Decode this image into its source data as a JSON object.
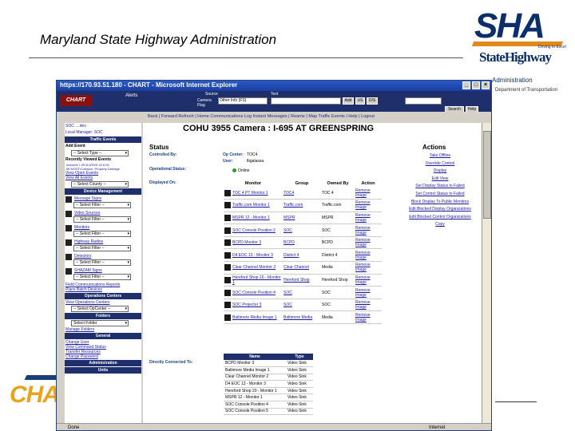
{
  "slide": {
    "title": "Maryland State Highway Administration",
    "logo": {
      "big": "SHA",
      "sub1": "StateHighway",
      "sub2": "Administration",
      "tiny": "Driving to Excel"
    },
    "side_text": "Department of Transportation",
    "bottom_logo": "CHA"
  },
  "browser": {
    "title": "https://170.93.51.180 - CHART - Microsoft Internet Explorer",
    "controls": [
      "_",
      "□",
      "×"
    ],
    "app_logo": "CHART",
    "alerts_label": "Alerts",
    "camera_label": "Camera Flag",
    "source_label": "Source",
    "text_label": "Text",
    "camera_select": "Other Info (FS)",
    "buttons": {
      "add": "Add",
      "us": "US",
      "dis": "D/S",
      "search": "Search",
      "help": "Help"
    },
    "menu": "Back | Forward   Refresh | Home   Communications Log   Instant Messages | Reame | Map   Traffic Events | Help | Logout",
    "status_text": "Done",
    "zone_text": "Internet"
  },
  "sidebar": {
    "top_lines": [
      "SOC  ....dev",
      "Local Manager: SOC"
    ],
    "traffic_events": {
      "header": "Traffic Events",
      "add_event_label": "Add Event",
      "select_type": "-- Select Type --",
      "recent_label": "Recently Viewed Events",
      "recent_items": [
        "Incident: I-95 at ATMS 20 A  00",
        "Mt MOST/Collision, Property Damage"
      ],
      "view_open": "View Open Events",
      "view_all": "View All Events",
      "select_county": "-- Select County --"
    },
    "device_mgmt": {
      "header": "Device Management",
      "items": [
        {
          "label": "Message Signs",
          "select": "-- Select Filter --"
        },
        {
          "label": "Video Sources",
          "select": "-- Select Filter --"
        },
        {
          "label": "Monitors",
          "select": "-- Select Filter --"
        },
        {
          "label": "Highway Radios",
          "select": "-- Select Filter --"
        },
        {
          "label": "Detectors",
          "select": "-- Select Filter --"
        },
        {
          "label": "SHAZAM Signs",
          "select": "-- Select Filter --"
        }
      ],
      "field_comm": "Field Communications Reports",
      "plans": "Plans Batch Devices"
    },
    "ops_centers": {
      "header": "Operations Centers",
      "view": "View Operations Centers",
      "select": "-- Select OpCenter --"
    },
    "folders": {
      "header": "Folders",
      "select": "Select Folder",
      "manage": "Manage Folders"
    },
    "general": {
      "header": "General",
      "links": [
        "Change User",
        "View Command Status",
        "Transfer Resources",
        "Change Password"
      ]
    },
    "admin": {
      "header": "Administration",
      "sub": "Units"
    }
  },
  "main": {
    "title": "COHU 3955 Camera : I-695 AT GREENSPRING",
    "status_heading": "Status",
    "controlled_by_label": "Controlled By:",
    "op_center_label": "Op Center:",
    "op_center_value": "TOC4",
    "user_label": "User:",
    "user_value": "lbgalassa",
    "op_status_label": "Operational Status:",
    "online": "Online",
    "displayed_on_label": "Displayed On:",
    "directly_connected_label": "Directly Connected To:",
    "actions_heading": "Actions",
    "actions": [
      "Take Offline",
      "Override Control",
      "Display",
      "Edit View",
      "Set Display Status to Failed",
      "Set Control Status to Failed",
      "Block Display To Public Monitors",
      "Edit Blocked Display Organizations",
      "Edit Blocked Control Organizations",
      "Copy"
    ],
    "monitor_table": {
      "headers": [
        "Monitor",
        "Group",
        "Owned By",
        "Action"
      ],
      "rows": [
        {
          "monitor": "TOC 4 PT Monitor 1",
          "group": "TOC4",
          "owned": "TOC 4",
          "action": "Remove Image"
        },
        {
          "monitor": "Traffic.com Monitor 1",
          "group": "Traffic.com",
          "owned": "Traffic.com",
          "action": "Remove Image"
        },
        {
          "monitor": "MSPR 12 - Monitor 1",
          "group": "MSPR",
          "owned": "MSPR",
          "action": "Remove Image"
        },
        {
          "monitor": "SOC Console Position 2",
          "group": "SOC",
          "owned": "SOC",
          "action": "Remove Image"
        },
        {
          "monitor": "BCPD Monitor 3",
          "group": "BCPD",
          "owned": "BCPD",
          "action": "Remove Image"
        },
        {
          "monitor": "D4 EOC 13 - Monitor 3",
          "group": "District 4",
          "owned": "District 4",
          "action": "Remove Image"
        },
        {
          "monitor": "Clear Channel Monitor 2",
          "group": "Clear Channel",
          "owned": "Media",
          "action": "Remove Image"
        },
        {
          "monitor": "Hereford Shop 20 - Monitor 1",
          "group": "Hereford Shop",
          "owned": "Hereford Shop",
          "action": "Remove Image"
        },
        {
          "monitor": "SOC Console Position 4",
          "group": "SOC",
          "owned": "SOC",
          "action": "Remove Image"
        },
        {
          "monitor": "SOC Projector 3",
          "group": "SOC",
          "owned": "SOC",
          "action": "Remove Image"
        },
        {
          "monitor": "Baltimore Media Image 1",
          "group": "Baltimore Media",
          "owned": "Media",
          "action": "Remove Image"
        }
      ]
    },
    "target_table": {
      "headers": [
        "Name",
        "Type"
      ],
      "rows": [
        {
          "name": "BCPD Monitor 3",
          "type": "Video Sink"
        },
        {
          "name": "Baltimore Media Image 1",
          "type": "Video Sink"
        },
        {
          "name": "Clear Channel Monitor 2",
          "type": "Video Sink"
        },
        {
          "name": "D4 EOC 13 - Monitor 3",
          "type": "Video Sink"
        },
        {
          "name": "Hereford Shop 20 - Monitor 1",
          "type": "Video Sink"
        },
        {
          "name": "MSPR 12 - Monitor 1",
          "type": "Video Sink"
        },
        {
          "name": "SOC Console Position 4",
          "type": "Video Sink"
        },
        {
          "name": "SOC Console Position 5",
          "type": "Video Sink"
        }
      ]
    }
  }
}
